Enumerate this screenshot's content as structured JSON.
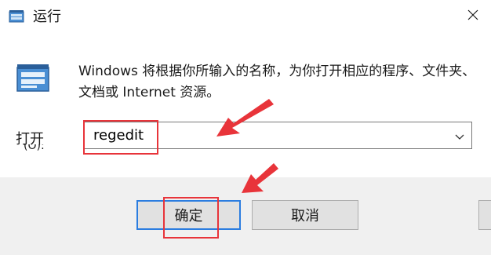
{
  "window": {
    "title": "运行",
    "title_icon": "run-dialog-icon",
    "close_icon": "close-icon"
  },
  "content": {
    "icon": "run-app-icon",
    "description": "Windows 将根据你所输入的名称，为你打开相应的程序、文件夹、文档或 Internet 资源。",
    "open_label": "打开",
    "open_label_clipped": "(O):"
  },
  "combo": {
    "value": "regedit",
    "arrow_icon": "chevron-down-icon"
  },
  "buttons": {
    "ok": "确定",
    "cancel": "取消"
  },
  "colors": {
    "annotation": "#e8343a",
    "focus_border": "#2b7de0",
    "bottom_band": "#f0f0f0"
  }
}
